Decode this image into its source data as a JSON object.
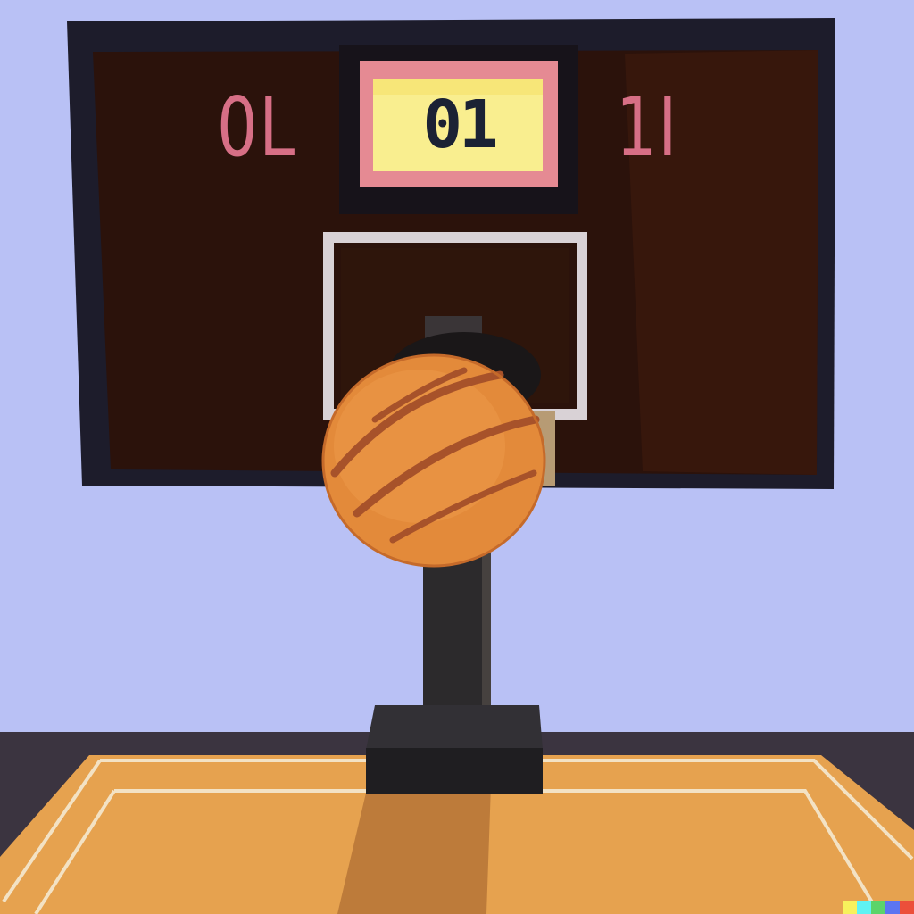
{
  "scene": {
    "wall_color": "#b9c1f5",
    "floor_color": "#e6a24f",
    "floor_line_color": "#f3e2c4"
  },
  "scoreboard": {
    "frame_color": "#1d1c2b",
    "panel_color": "#2b120b",
    "home_score": "0L",
    "away_score": "1I",
    "score_color": "#d76f86",
    "timer": {
      "text": "01",
      "bg_color": "#f9ee8f",
      "border_color": "#e58a93"
    }
  },
  "hoop": {
    "square_color": "#d9d2d6"
  },
  "ball": {
    "color": "#e38a3a",
    "seam_color": "#a7522a"
  },
  "stand": {
    "color": "#2c2a2c",
    "base_color": "#1f1e21"
  },
  "badge": {
    "colors": [
      "#f7f15c",
      "#5ff2f3",
      "#5bd46a",
      "#5b75f2",
      "#ec4f3a"
    ]
  }
}
